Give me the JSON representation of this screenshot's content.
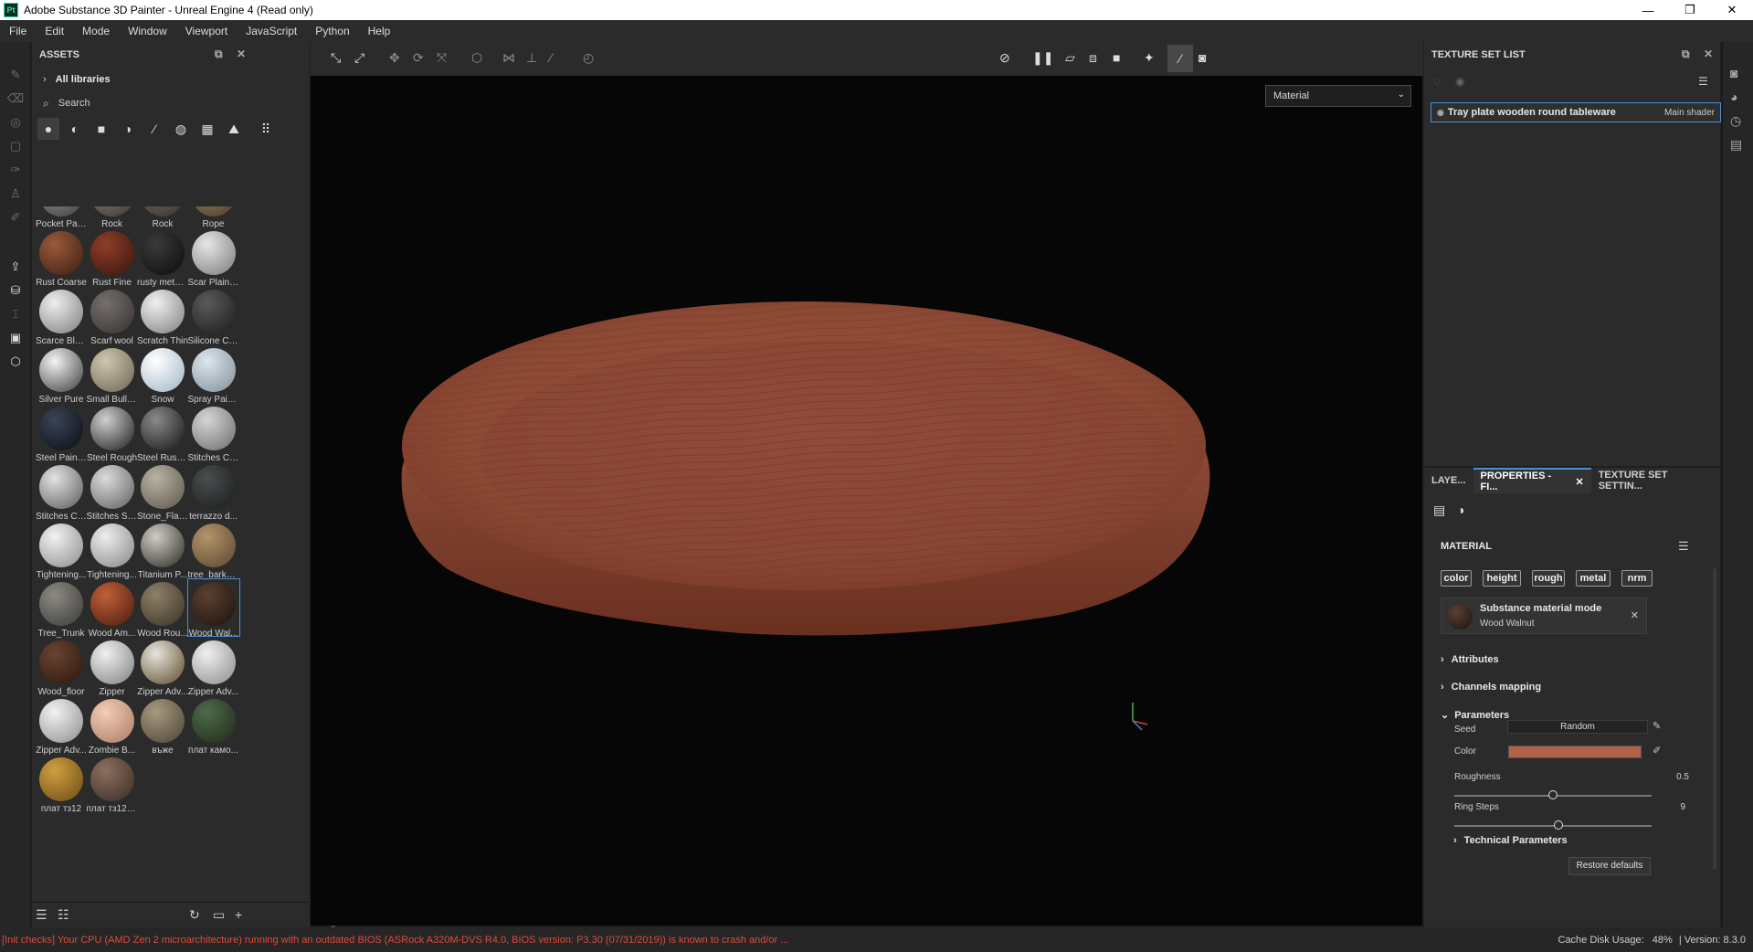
{
  "app": {
    "title": "Adobe Substance 3D Painter - Unreal Engine 4 (Read only)",
    "logo": "Pt"
  },
  "window_controls": [
    "—",
    "❐",
    "✕"
  ],
  "menu": [
    "File",
    "Edit",
    "Mode",
    "Window",
    "Viewport",
    "JavaScript",
    "Python",
    "Help"
  ],
  "assets": {
    "title": "ASSETS",
    "libraries": "All libraries",
    "search_placeholder": "Search",
    "items": [
      {
        "label": "Pocket Pat...",
        "c1": "#9a9a9a",
        "c2": "#3c3c3c"
      },
      {
        "label": "Rock",
        "c1": "#8c8478",
        "c2": "#3a362f"
      },
      {
        "label": "Rock",
        "c1": "#7d7468",
        "c2": "#332e28"
      },
      {
        "label": "Rope",
        "c1": "#a08a62",
        "c2": "#45392a"
      },
      {
        "label": "Rust Coarse",
        "c1": "#9a5a3c",
        "c2": "#3a1e12"
      },
      {
        "label": "Rust Fine",
        "c1": "#8e3e2a",
        "c2": "#3a140c"
      },
      {
        "label": "rusty metal...",
        "c1": "#3a3a3a",
        "c2": "#0c0c0c"
      },
      {
        "label": "Scar Plain ...",
        "c1": "#e6e6e6",
        "c2": "#7a7a7a"
      },
      {
        "label": "Scarce Blo...",
        "c1": "#eeeeee",
        "c2": "#7c7c7c"
      },
      {
        "label": "Scarf wool",
        "c1": "#76706c",
        "c2": "#353130"
      },
      {
        "label": "Scratch Thin",
        "c1": "#f0f0f0",
        "c2": "#7e7e7e"
      },
      {
        "label": "Silicone Coat",
        "c1": "#5a5a5a",
        "c2": "#1c1c1c"
      },
      {
        "label": "Silver Pure",
        "c1": "#f4f4f4",
        "c2": "#3a3a3a"
      },
      {
        "label": "Small Bulle...",
        "c1": "#cfc6b0",
        "c2": "#6d6552"
      },
      {
        "label": "Snow",
        "c1": "#ffffff",
        "c2": "#9fb4c4"
      },
      {
        "label": "Spray Pain...",
        "c1": "#dce6ee",
        "c2": "#7f8e98"
      },
      {
        "label": "Steel Painted",
        "c1": "#3a4458",
        "c2": "#0a0d14"
      },
      {
        "label": "Steel Rough",
        "c1": "#cfcfcf",
        "c2": "#1c1c1c"
      },
      {
        "label": "Steel Rust ...",
        "c1": "#8a8a8a",
        "c2": "#141414"
      },
      {
        "label": "Stitches Co...",
        "c1": "#d6d6d6",
        "c2": "#6a6a6a"
      },
      {
        "label": "Stitches Cr...",
        "c1": "#e2e2e2",
        "c2": "#5a5a5a"
      },
      {
        "label": "Stitches Str...",
        "c1": "#dcdcdc",
        "c2": "#5e5e5e"
      },
      {
        "label": "Stone_Flat_...",
        "c1": "#b8b2a2",
        "c2": "#5c574c"
      },
      {
        "label": "terrazzo d...",
        "c1": "#4a4e4e",
        "c2": "#1a1c1c"
      },
      {
        "label": "Tightening...",
        "c1": "#f2f2f2",
        "c2": "#8a8a8a"
      },
      {
        "label": "Tightening...",
        "c1": "#eeeeee",
        "c2": "#858585"
      },
      {
        "label": "Titanium P...",
        "c1": "#d0ccc4",
        "c2": "#2a2826"
      },
      {
        "label": "tree_bark_v1",
        "c1": "#b4936a",
        "c2": "#5a4630"
      },
      {
        "label": "Tree_Trunk",
        "c1": "#8c8a84",
        "c2": "#3c3a36"
      },
      {
        "label": "Wood Am...",
        "c1": "#c0603a",
        "c2": "#4a1a0c"
      },
      {
        "label": "Wood Rou...",
        "c1": "#8e8068",
        "c2": "#3a3226"
      },
      {
        "label": "Wood Wal...",
        "c1": "#5a4032",
        "c2": "#1c120c"
      },
      {
        "label": "Wood_floor",
        "c1": "#6a4432",
        "c2": "#2a160c"
      },
      {
        "label": "Zipper",
        "c1": "#f0f0f0",
        "c2": "#7e7e7e"
      },
      {
        "label": "Zipper Adv...",
        "c1": "#e8e4dc",
        "c2": "#5a4a2a"
      },
      {
        "label": "Zipper Adv...",
        "c1": "#f0f0f0",
        "c2": "#8a8a8a"
      },
      {
        "label": "Zipper Adv...",
        "c1": "#f2f2f2",
        "c2": "#8c8c8c"
      },
      {
        "label": "Zombie B...",
        "c1": "#f4cdb6",
        "c2": "#a87a64"
      },
      {
        "label": "въже",
        "c1": "#a89a80",
        "c2": "#4a4234"
      },
      {
        "label": "плат камо...",
        "c1": "#4e6a48",
        "c2": "#1e2a1c"
      },
      {
        "label": "плат тз12",
        "c1": "#d0a040",
        "c2": "#6a4a14"
      },
      {
        "label": "плат тз12346",
        "c1": "#8c7060",
        "c2": "#3a2a22"
      }
    ]
  },
  "viewport": {
    "material_mode": "Material",
    "background": "#060606",
    "plate_color": "#8a4632"
  },
  "texture_set_list": {
    "title": "TEXTURE SET LIST",
    "item": "Tray plate wooden round tableware",
    "shader": "Main shader"
  },
  "properties": {
    "tabs": [
      "LAYE...",
      "PROPERTIES - FI...",
      "TEXTURE SET SETTIN..."
    ],
    "section": "MATERIAL",
    "channels": [
      "color",
      "height",
      "rough",
      "metal",
      "nrm"
    ],
    "mode_title": "Substance material mode",
    "material_name": "Wood Walnut",
    "attributes": "Attributes",
    "channels_mapping": "Channels mapping",
    "parameters": "Parameters",
    "seed_label": "Seed",
    "seed_value": "Random",
    "color_label": "Color",
    "color_value": "#b0634a",
    "roughness_label": "Roughness",
    "roughness_value": "0.5",
    "roughness_fraction": 0.5,
    "ring_label": "Ring Steps",
    "ring_value": "9",
    "ring_fraction": 0.53,
    "technical": "Technical Parameters",
    "restore": "Restore defaults"
  },
  "status": {
    "warning": "[Init checks] Your CPU (AMD Zen 2 microarchitecture) running with an outdated BIOS (ASRock A320M-DVS R4.0, BIOS version: P3.30 (07/31/2019)) is known to crash and/or ...",
    "cache": "Cache Disk Usage:",
    "cache_pct": "48%",
    "version": "| Version: 8.3.0"
  }
}
